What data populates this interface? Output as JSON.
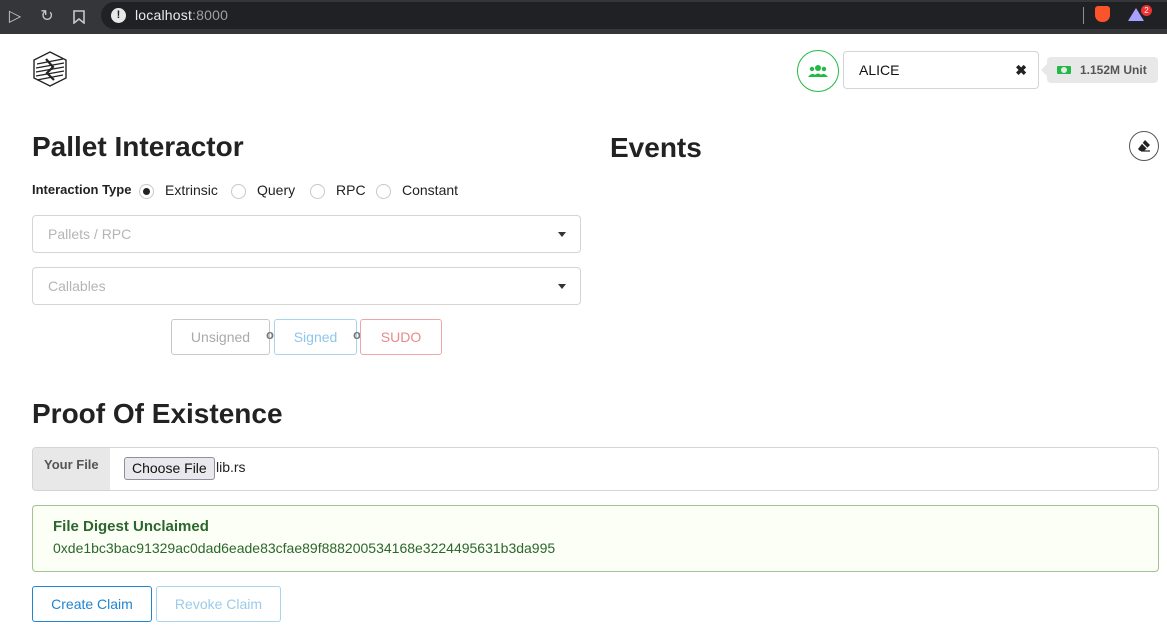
{
  "browser": {
    "url_host": "localhost",
    "url_port": ":8000",
    "brave_badge": "2"
  },
  "header": {
    "account": "ALICE",
    "balance": "1.152M Unit"
  },
  "pallet": {
    "title": "Pallet Interactor",
    "interaction_label": "Interaction Type",
    "types": [
      "Extrinsic",
      "Query",
      "RPC",
      "Constant"
    ],
    "selected": "Extrinsic",
    "pallets_placeholder": "Pallets / RPC",
    "callables_placeholder": "Callables",
    "unsigned": "Unsigned",
    "or": "or",
    "signed": "Signed",
    "sudo": "SUDO"
  },
  "events": {
    "title": "Events"
  },
  "poe": {
    "title": "Proof Of Existence",
    "file_label": "Your File",
    "choose_button": "Choose File",
    "file_name": "lib.rs",
    "digest_title": "File Digest Unclaimed",
    "digest_hash": "0xde1bc3bac91329ac0dad6eade83cfae89f888200534168e3224495631b3da995",
    "create_claim": "Create Claim",
    "revoke_claim": "Revoke Claim"
  },
  "colors": {
    "green": "#21ba45",
    "blue": "#2185d0",
    "red": "#db2828",
    "success_text": "#2c662d"
  }
}
